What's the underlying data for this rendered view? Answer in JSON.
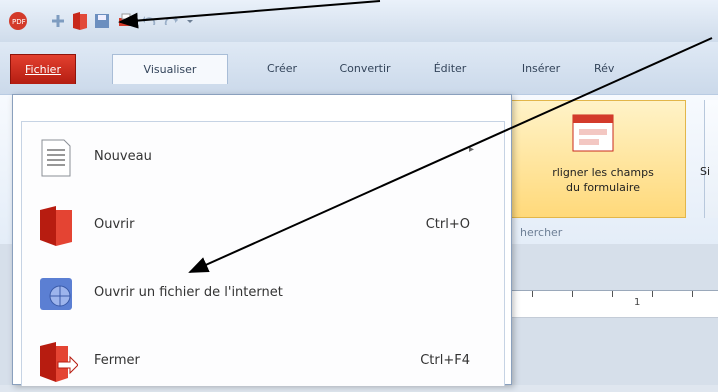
{
  "tabs": [
    {
      "label": "Fichier"
    },
    {
      "label": "Visualiser"
    },
    {
      "label": "Créer"
    },
    {
      "label": "Convertir"
    },
    {
      "label": "Éditer"
    },
    {
      "label": "Insérer"
    },
    {
      "label": "Rév"
    }
  ],
  "ribbon": {
    "highlight_button": "rligner les champs\ndu formulaire",
    "group_label": "hercher",
    "side_label": "Si"
  },
  "menu": {
    "items": [
      {
        "label": "Nouveau",
        "shortcut": "",
        "has_submenu": true,
        "icon": "new-document-icon"
      },
      {
        "label": "Ouvrir",
        "shortcut": "Ctrl+O",
        "has_submenu": false,
        "icon": "open-book-icon"
      },
      {
        "label": "Ouvrir un fichier de l'internet",
        "shortcut": "",
        "has_submenu": false,
        "icon": "internet-file-icon"
      },
      {
        "label": "Fermer",
        "shortcut": "Ctrl+F4",
        "has_submenu": false,
        "icon": "close-file-icon"
      }
    ]
  },
  "ruler_tick_label": "1",
  "colors": {
    "file_tab": "#c8281b",
    "highlight": "#ffd97a",
    "menu_border": "#8aa0bd"
  }
}
